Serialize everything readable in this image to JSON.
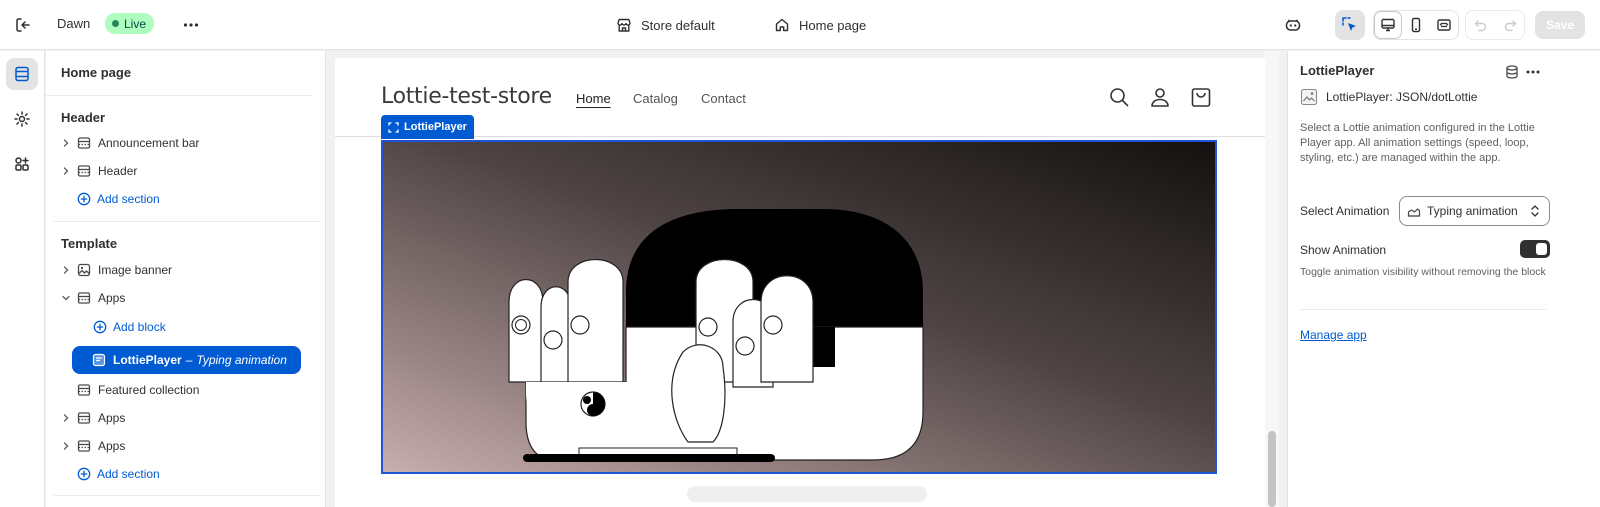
{
  "topbar": {
    "theme_name": "Dawn",
    "status_badge": "Live",
    "store_selector": "Store default",
    "page_selector": "Home page",
    "save_label": "Save"
  },
  "sidebar": {
    "title": "Home page",
    "header_group": {
      "title": "Header",
      "items": [
        {
          "label": "Announcement bar"
        },
        {
          "label": "Header"
        }
      ],
      "add_label": "Add section"
    },
    "template_group": {
      "title": "Template",
      "image_banner": "Image banner",
      "apps_label": "Apps",
      "add_block_label": "Add block",
      "selected_block": {
        "name": "LottiePlayer",
        "separator": "–",
        "subtitle": "Typing animation"
      },
      "featured_collection": "Featured collection",
      "apps_2": "Apps",
      "apps_3": "Apps",
      "add_label": "Add section"
    }
  },
  "preview": {
    "store_name": "Lottie-test-store",
    "nav": [
      "Home",
      "Catalog",
      "Contact"
    ],
    "block_tag": "LottiePlayer"
  },
  "inspector": {
    "title": "LottiePlayer",
    "app_name": "LottiePlayer: JSON/dotLottie",
    "description": "Select a Lottie animation configured in the Lottie Player app. All animation settings (speed, loop, styling, etc.) are managed within the app.",
    "select_label": "Select Animation",
    "select_value": "Typing animation",
    "toggle_label": "Show Animation",
    "toggle_on": true,
    "toggle_help": "Toggle animation visibility without removing the block",
    "manage_link": "Manage app"
  },
  "colors": {
    "accent": "#005bd3",
    "live_badge_bg": "#affebf",
    "selection_border": "#1f54d7"
  }
}
